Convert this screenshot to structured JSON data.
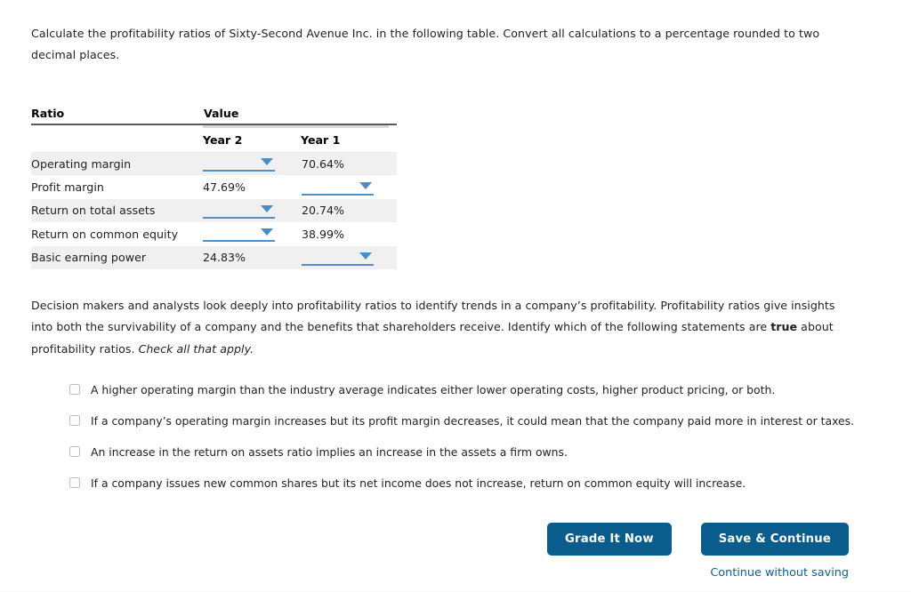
{
  "intro": {
    "text": "Calculate the profitability ratios of Sixty-Second Avenue Inc. in the following table. Convert all calculations to a percentage rounded to two decimal places."
  },
  "table": {
    "header": {
      "ratio": "Ratio",
      "value": "Value",
      "year2": "Year 2",
      "year1": "Year 1"
    },
    "rows": [
      {
        "name": "Operating margin",
        "year2": "",
        "year2_type": "dropdown",
        "year1": "70.64%",
        "year1_type": "static"
      },
      {
        "name": "Profit margin",
        "year2": "47.69%",
        "year2_type": "static",
        "year1": "",
        "year1_type": "dropdown"
      },
      {
        "name": "Return on total assets",
        "year2": "",
        "year2_type": "dropdown",
        "year1": "20.74%",
        "year1_type": "static"
      },
      {
        "name": "Return on common equity",
        "year2": "",
        "year2_type": "dropdown",
        "year1": "38.99%",
        "year1_type": "static"
      },
      {
        "name": "Basic earning power",
        "year2": "24.83%",
        "year2_type": "static",
        "year1": "",
        "year1_type": "dropdown"
      }
    ]
  },
  "body": {
    "part1": "Decision makers and analysts look deeply into profitability ratios to identify trends in a company’s profitability. Profitability ratios give insights into both the survivability of a company and the benefits that shareholders receive. Identify which of the following statements are ",
    "emphasis": "true",
    "part2": " about profitability ratios. ",
    "instruction": "Check all that apply."
  },
  "choices": [
    {
      "label": "A higher operating margin than the industry average indicates either lower operating costs, higher product pricing, or both.",
      "checked": false
    },
    {
      "label": "If a company’s operating margin increases but its profit margin decreases, it could mean that the company paid more in interest or taxes.",
      "checked": false
    },
    {
      "label": "An increase in the return on assets ratio implies an increase in the assets a firm owns.",
      "checked": false
    },
    {
      "label": "If a company issues new common shares but its net income does not increase, return on common equity will increase.",
      "checked": false
    }
  ],
  "actions": {
    "grade_label": "Grade It Now",
    "save_label": "Save & Continue",
    "continue_without_saving_label": "Continue without saving"
  },
  "colors": {
    "button_blue": "#0a5c8c",
    "link_blue": "#0d5e94",
    "dropdown_blue": "#5590c4",
    "row_shade": "#f0f0f0",
    "rule_dark": "#595959",
    "rule_light": "#d9d9d9"
  }
}
